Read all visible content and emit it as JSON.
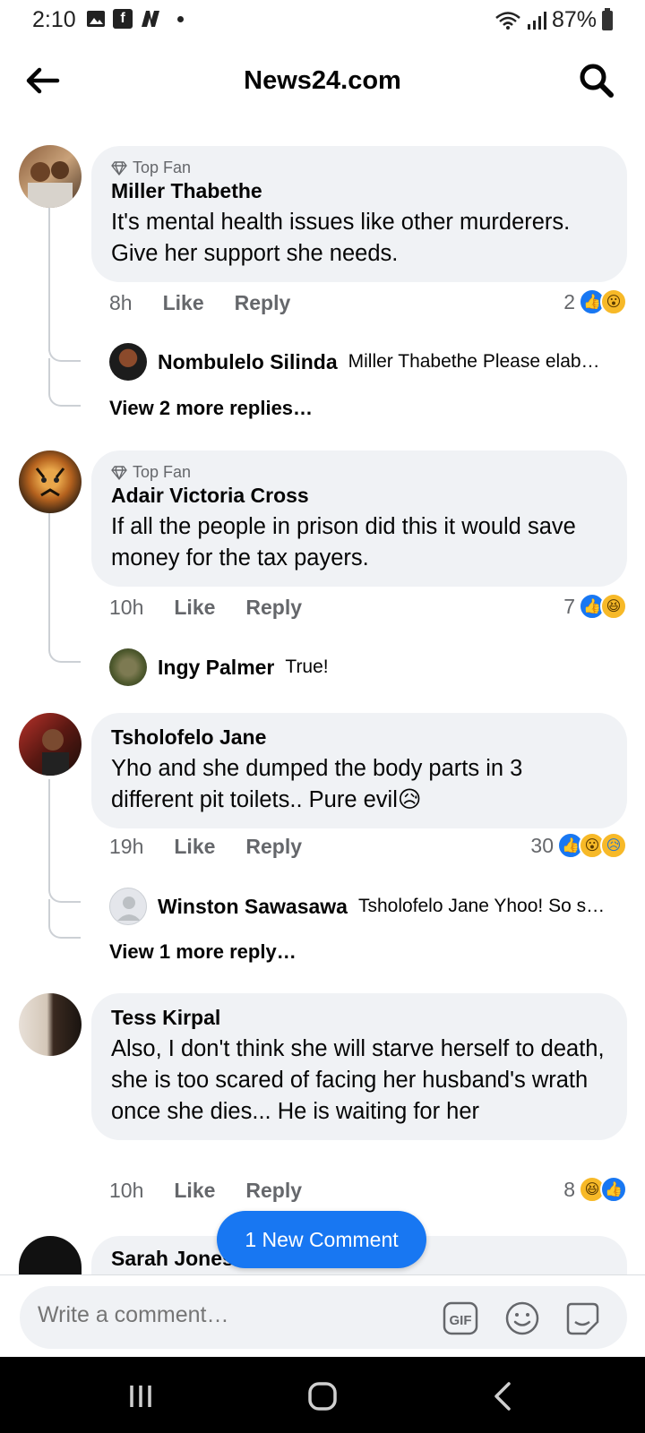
{
  "status_bar": {
    "time": "2:10",
    "battery": "87%"
  },
  "header": {
    "title": "News24.com"
  },
  "badge_label": "Top Fan",
  "comments": [
    {
      "badge": "Top Fan",
      "author": "Miller Thabethe",
      "text": "It's mental health issues like other murderers. Give her support she needs.",
      "time": "8h",
      "like": "Like",
      "reply": "Reply",
      "reaction_count": "2",
      "reactions": [
        "like-icon",
        "wow-icon"
      ],
      "replies": [
        {
          "author": "Nombulelo Silinda",
          "text": "Miller Thabethe Please elab…"
        }
      ],
      "view_more": "View 2 more replies…"
    },
    {
      "badge": "Top Fan",
      "author": "Adair Victoria Cross",
      "text": "If all the people in prison did this it would save money for the tax payers.",
      "time": "10h",
      "like": "Like",
      "reply": "Reply",
      "reaction_count": "7",
      "reactions": [
        "like-icon",
        "haha-icon"
      ],
      "replies": [
        {
          "author": "Ingy Palmer",
          "text": "True!"
        }
      ]
    },
    {
      "author": "Tsholofelo Jane",
      "text": "Yho and she dumped the body parts in 3 different pit toilets.. Pure evil😥",
      "time": "19h",
      "like": "Like",
      "reply": "Reply",
      "reaction_count": "30",
      "reactions": [
        "like-icon",
        "wow-icon",
        "sad-icon"
      ],
      "replies": [
        {
          "author": "Winston Sawasawa",
          "text": "Tsholofelo Jane Yhoo! So s…"
        }
      ],
      "view_more": "View 1 more reply…"
    },
    {
      "author": "Tess Kirpal",
      "text": "Also, I don't think she will starve herself to death, she is too scared of facing her husband's wrath once she dies... He is waiting for her",
      "time": "10h",
      "like": "Like",
      "reply": "Reply",
      "reaction_count": "8",
      "reactions": [
        "haha-icon",
        "like-icon"
      ]
    },
    {
      "author": "Sarah Jones"
    }
  ],
  "new_comment_button": "1 New Comment",
  "composer": {
    "placeholder": "Write a comment…",
    "gif_label": "GIF"
  },
  "colors": {
    "accent": "#1877f2",
    "bubble": "#f0f2f5",
    "muted": "#65676b"
  }
}
